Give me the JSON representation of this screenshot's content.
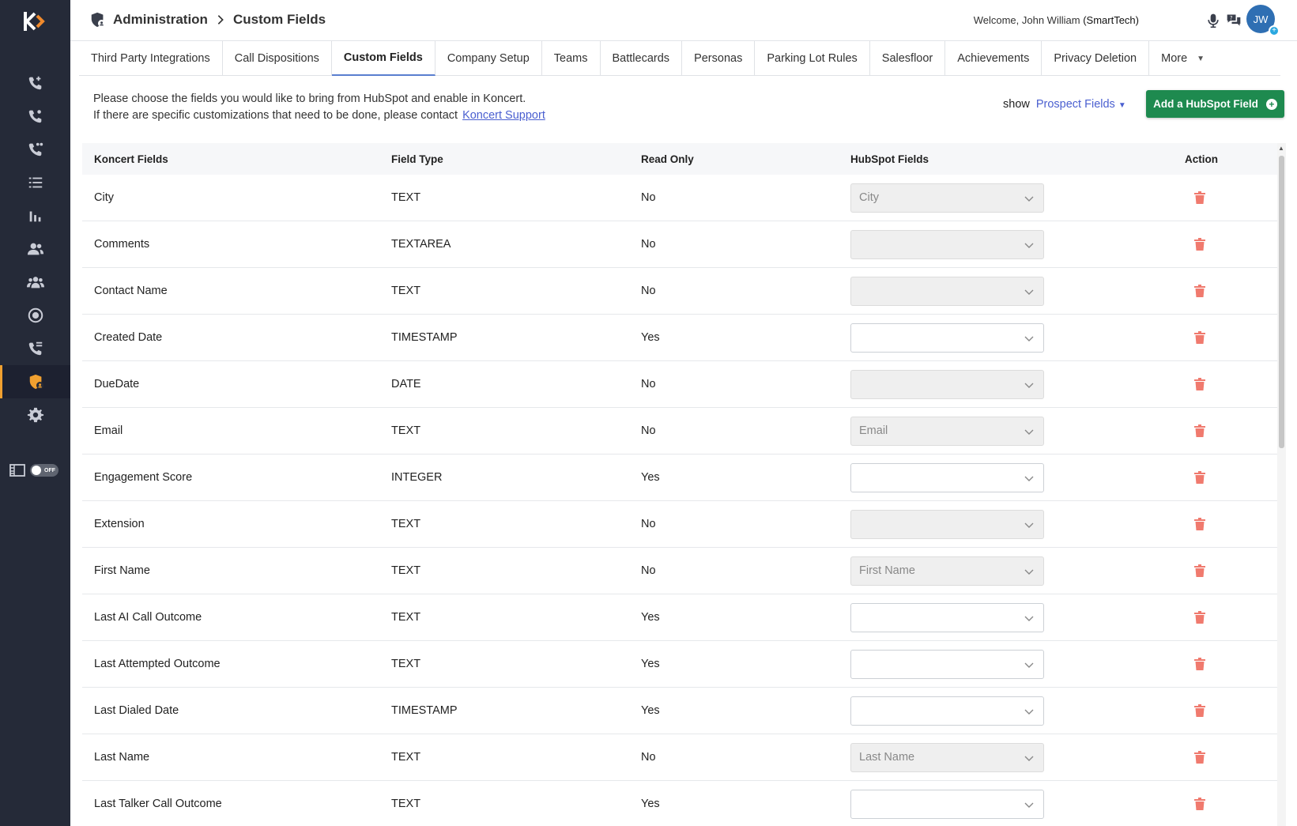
{
  "header": {
    "breadcrumb_section": "Administration",
    "breadcrumb_page": "Custom Fields",
    "welcome_prefix": "Welcome, John William",
    "welcome_company": "(SmartTech)",
    "avatar_initials": "JW"
  },
  "sidebar": {
    "demo_toggle_label": "OFF"
  },
  "tabs": [
    {
      "label": "Third Party Integrations"
    },
    {
      "label": "Call Dispositions"
    },
    {
      "label": "Custom Fields"
    },
    {
      "label": "Company Setup"
    },
    {
      "label": "Teams"
    },
    {
      "label": "Battlecards"
    },
    {
      "label": "Personas"
    },
    {
      "label": "Parking Lot Rules"
    },
    {
      "label": "Salesfloor"
    },
    {
      "label": "Achievements"
    },
    {
      "label": "Privacy Deletion"
    },
    {
      "label": "More"
    }
  ],
  "intro": {
    "line1": "Please choose the fields you would like to bring from HubSpot and enable in Koncert.",
    "line2": "If there are specific customizations that need to be done, please contact",
    "link": "Koncert Support"
  },
  "filter": {
    "show_label": "show",
    "selected": "Prospect Fields"
  },
  "add_button_label": "Add a HubSpot Field",
  "table": {
    "headers": {
      "name": "Koncert Fields",
      "type": "Field Type",
      "read_only": "Read Only",
      "hubspot": "HubSpot Fields",
      "action": "Action"
    },
    "rows": [
      {
        "name": "City",
        "type": "TEXT",
        "read_only": "No",
        "hubspot": "City"
      },
      {
        "name": "Comments",
        "type": "TEXTAREA",
        "read_only": "No",
        "hubspot": ""
      },
      {
        "name": "Contact Name",
        "type": "TEXT",
        "read_only": "No",
        "hubspot": ""
      },
      {
        "name": "Created Date",
        "type": "TIMESTAMP",
        "read_only": "Yes",
        "hubspot": ""
      },
      {
        "name": "DueDate",
        "type": "DATE",
        "read_only": "No",
        "hubspot": ""
      },
      {
        "name": "Email",
        "type": "TEXT",
        "read_only": "No",
        "hubspot": "Email"
      },
      {
        "name": "Engagement Score",
        "type": "INTEGER",
        "read_only": "Yes",
        "hubspot": ""
      },
      {
        "name": "Extension",
        "type": "TEXT",
        "read_only": "No",
        "hubspot": ""
      },
      {
        "name": "First Name",
        "type": "TEXT",
        "read_only": "No",
        "hubspot": "First Name"
      },
      {
        "name": "Last AI Call Outcome",
        "type": "TEXT",
        "read_only": "Yes",
        "hubspot": ""
      },
      {
        "name": "Last Attempted Outcome",
        "type": "TEXT",
        "read_only": "Yes",
        "hubspot": ""
      },
      {
        "name": "Last Dialed Date",
        "type": "TIMESTAMP",
        "read_only": "Yes",
        "hubspot": ""
      },
      {
        "name": "Last Name",
        "type": "TEXT",
        "read_only": "No",
        "hubspot": "Last Name"
      },
      {
        "name": "Last Talker Call Outcome",
        "type": "TEXT",
        "read_only": "Yes",
        "hubspot": ""
      }
    ]
  },
  "colors": {
    "sidebar": "#252a38",
    "accent_green": "#1e8a4f",
    "link_blue": "#4a5fd0",
    "trash_red": "#f07a6e"
  }
}
